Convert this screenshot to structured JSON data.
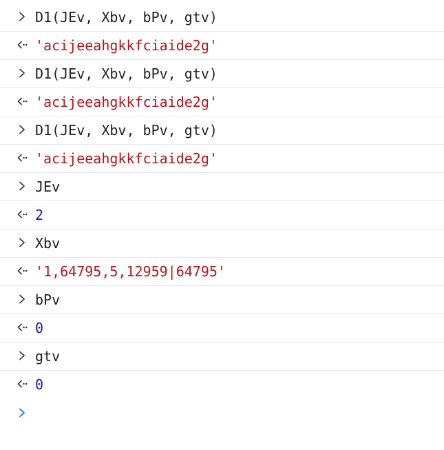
{
  "console": {
    "entries": [
      {
        "kind": "input",
        "text": "D1(JEv, Xbv, bPv, gtv)"
      },
      {
        "kind": "output",
        "type": "string",
        "text": "'acijeeahgkkfciaide2g'"
      },
      {
        "kind": "input",
        "text": "D1(JEv, Xbv, bPv, gtv)"
      },
      {
        "kind": "output",
        "type": "string",
        "text": "'acijeeahgkkfciaide2g'"
      },
      {
        "kind": "input",
        "text": "D1(JEv, Xbv, bPv, gtv)"
      },
      {
        "kind": "output",
        "type": "string",
        "text": "'acijeeahgkkfciaide2g'"
      },
      {
        "kind": "input",
        "text": "JEv"
      },
      {
        "kind": "output",
        "type": "number",
        "text": "2"
      },
      {
        "kind": "input",
        "text": "Xbv"
      },
      {
        "kind": "output",
        "type": "string",
        "text": "'1,64795,5,12959|64795'"
      },
      {
        "kind": "input",
        "text": "bPv"
      },
      {
        "kind": "output",
        "type": "number",
        "text": "0"
      },
      {
        "kind": "input",
        "text": "gtv"
      },
      {
        "kind": "output",
        "type": "number",
        "text": "0"
      }
    ],
    "prompt_value": ""
  },
  "colors": {
    "input_text": "#1f1f1f",
    "string_value": "#b8141b",
    "number_value": "#1a1aa6",
    "input_marker": "#3c4043",
    "prompt_marker": "#1a73e8",
    "row_divider": "#e4e8ee"
  },
  "icons": {
    "input": "chevron-right-icon",
    "output": "return-arrow-icon",
    "prompt": "prompt-chevron-icon"
  }
}
